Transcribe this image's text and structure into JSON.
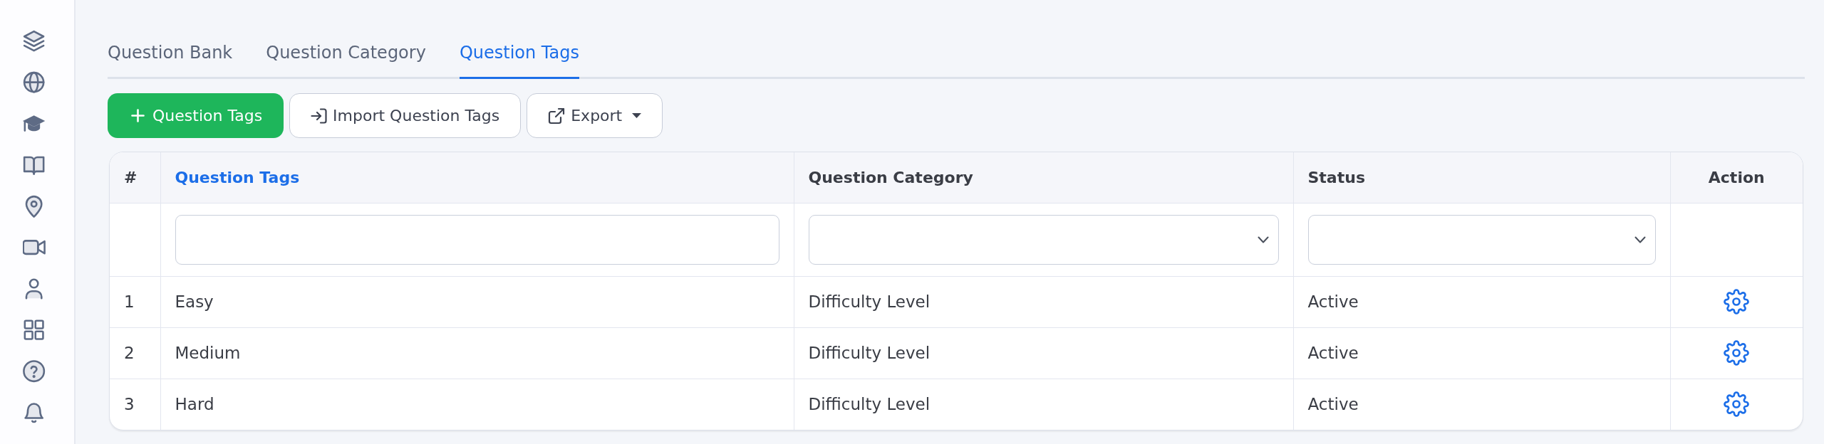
{
  "sidebar": {
    "items": [
      {
        "kind": "layers"
      },
      {
        "kind": "globe"
      },
      {
        "kind": "cap"
      },
      {
        "kind": "book"
      },
      {
        "kind": "pin"
      },
      {
        "kind": "video"
      },
      {
        "kind": "user"
      },
      {
        "kind": "grid"
      },
      {
        "kind": "help"
      },
      {
        "kind": "bell"
      }
    ]
  },
  "tabs": [
    {
      "label": "Question Bank",
      "selected": false
    },
    {
      "label": "Question Category",
      "selected": false
    },
    {
      "label": "Question Tags",
      "selected": true
    }
  ],
  "toolbar": {
    "buttons": [
      {
        "kind": "add",
        "label": "Question Tags"
      },
      {
        "kind": "import",
        "label": "Import Question Tags"
      },
      {
        "kind": "export",
        "label": "Export"
      }
    ]
  },
  "table": {
    "columns": [
      {
        "label": "#",
        "sorted": false
      },
      {
        "label": "Question Tags",
        "sorted": true
      },
      {
        "label": "Question Category",
        "sorted": false
      },
      {
        "label": "Status",
        "sorted": false
      },
      {
        "label": "Action",
        "sorted": false
      }
    ],
    "filters": [
      {
        "kind": "blank"
      },
      {
        "kind": "text"
      },
      {
        "kind": "select"
      },
      {
        "kind": "select"
      },
      {
        "kind": "blank"
      }
    ],
    "rows": [
      {
        "cells": [
          "1",
          "Easy",
          "Difficulty Level",
          "Active"
        ]
      },
      {
        "cells": [
          "2",
          "Medium",
          "Difficulty Level",
          "Active"
        ]
      },
      {
        "cells": [
          "3",
          "Hard",
          "Difficulty Level",
          "Active"
        ]
      }
    ]
  }
}
